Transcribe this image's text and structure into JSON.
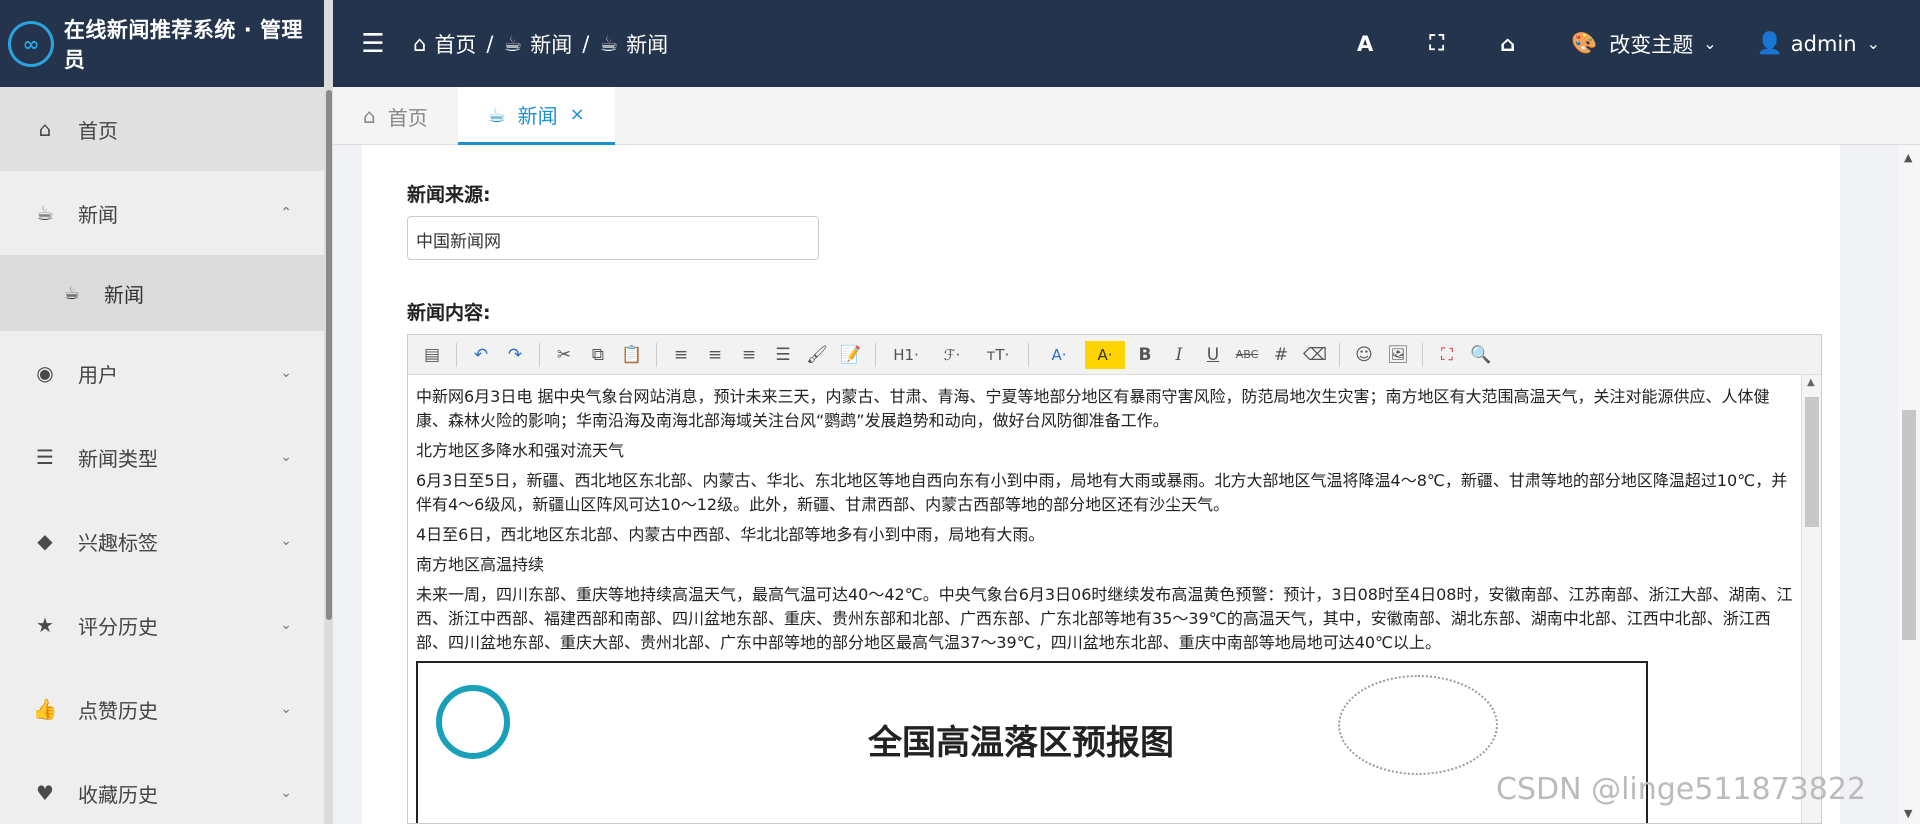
{
  "brand": {
    "title": "在线新闻推荐系统 · 管理员"
  },
  "header": {
    "breadcrumb": [
      "首页",
      "新闻",
      "新闻"
    ],
    "font_btn": "A",
    "theme_label": "改变主题",
    "user_label": "admin"
  },
  "sidebar": {
    "items": [
      {
        "label": "首页",
        "icon": "home-icon"
      },
      {
        "label": "新闻",
        "icon": "coffee-icon"
      },
      {
        "label": "新闻",
        "icon": "coffee-icon"
      },
      {
        "label": "用户",
        "icon": "user-circle-icon"
      },
      {
        "label": "新闻类型",
        "icon": "list-icon"
      },
      {
        "label": "兴趣标签",
        "icon": "tags-icon"
      },
      {
        "label": "评分历史",
        "icon": "star-icon"
      },
      {
        "label": "点赞历史",
        "icon": "thumbs-up-icon"
      },
      {
        "label": "收藏历史",
        "icon": "heart-icon"
      }
    ]
  },
  "tabs": [
    {
      "label": "首页"
    },
    {
      "label": "新闻",
      "close": "×"
    }
  ],
  "form": {
    "source_label": "新闻来源:",
    "source_value": "中国新闻网",
    "content_label": "新闻内容:"
  },
  "editor": {
    "toolbar": {
      "h1": "H1·",
      "font": "ℱ·",
      "size": "ᴛT·",
      "color": "A·",
      "bg": "A·",
      "bold": "B",
      "italic": "I",
      "underline": "U",
      "strike": "ABC"
    },
    "paragraphs": [
      "中新网6月3日电 据中央气象台网站消息，预计未来三天，内蒙古、甘肃、青海、宁夏等地部分地区有暴雨守害风险，防范局地次生灾害；南方地区有大范围高温天气，关注对能源供应、人体健康、森林火险的影响；华南沿海及南海北部海域关注台风“鹦鹉”发展趋势和动向，做好台风防御准备工作。",
      "北方地区多降水和强对流天气",
      "6月3日至5日，新疆、西北地区东北部、内蒙古、华北、东北地区等地自西向东有小到中雨，局地有大雨或暴雨。北方大部地区气温将降温4～8℃，新疆、甘肃等地的部分地区降温超过10℃，并伴有4～6级风，新疆山区阵风可达10～12级。此外，新疆、甘肃西部、内蒙古西部等地的部分地区还有沙尘天气。",
      "4日至6日，西北地区东北部、内蒙古中西部、华北北部等地多有小到中雨，局地有大雨。",
      "南方地区高温持续",
      "未来一周，四川东部、重庆等地持续高温天气，最高气温可达40～42℃。中央气象台6月3日06时继续发布高温黄色预警：预计，3日08时至4日08时，安徽南部、江苏南部、浙江大部、湖南、江西、浙江中西部、福建西部和南部、四川盆地东部、重庆、贵州东部和北部、广西东部、广东北部等地有35～39℃的高温天气，其中，安徽南部、湖北东部、湖南中北部、江西中北部、浙江西部、四川盆地东部、重庆大部、贵州北部、广东中部等地的部分地区最高气温37～39℃，四川盆地东北部、重庆中南部等地局地可达40℃以上。"
    ],
    "figure_title": "全国高温落区预报图"
  },
  "watermark": "CSDN @linge511873822",
  "colors": {
    "header": "#24344c",
    "accent": "#1e90d0"
  }
}
